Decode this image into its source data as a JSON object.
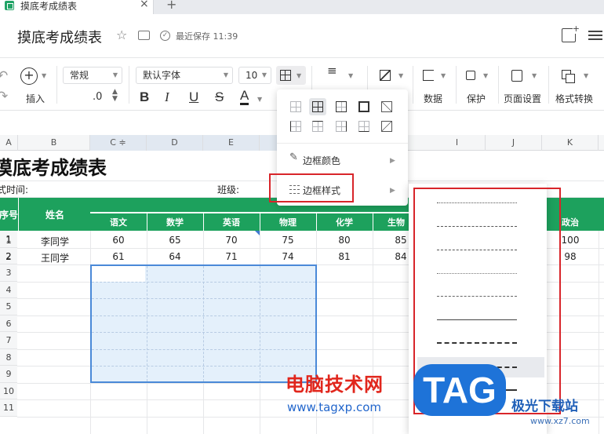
{
  "tab": {
    "title": "摸底考成绩表",
    "close": "×",
    "new": "+"
  },
  "header": {
    "title": "摸底考成绩表",
    "saved": "最近保存 11:39",
    "star": "☆"
  },
  "toolbar": {
    "insert_label": "插入",
    "number_format": "常规",
    "decimal": ".0",
    "font_name": "默认字体",
    "font_size": "10",
    "bold": "B",
    "italic": "I",
    "underline": "U",
    "strike": "S",
    "fontcolor": "A",
    "data_label": "数据",
    "protect_label": "保护",
    "page_setup_label": "页面设置",
    "format_convert_label": "格式转换"
  },
  "columns": [
    "A",
    "B",
    "C",
    "D",
    "E",
    "F",
    "I",
    "J",
    "K"
  ],
  "sheet": {
    "title": "摸底考成绩表",
    "exam_time": "式时间:",
    "class_label": "班级:",
    "header_seq": "序号",
    "header_name": "姓名",
    "subjects": [
      "语文",
      "数学",
      "英语",
      "物理",
      "化学",
      "生物",
      "政治"
    ],
    "rows": [
      {
        "seq": "1",
        "name": "李同学",
        "scores": [
          "60",
          "65",
          "70",
          "75",
          "80",
          "85",
          "100"
        ]
      },
      {
        "seq": "2",
        "name": "王同学",
        "scores": [
          "61",
          "64",
          "71",
          "74",
          "81",
          "84",
          "98"
        ]
      }
    ],
    "row_numbers": [
      "1",
      "2",
      "3",
      "4",
      "5",
      "6",
      "7",
      "8",
      "9",
      "10",
      "11"
    ]
  },
  "menu": {
    "border_color": "边框颜色",
    "border_style": "边框样式"
  },
  "watermark": {
    "site_cn": "电脑技术网",
    "site_url": "www.tagxp.com",
    "tag": "TAG",
    "brand": "极光下载站",
    "brand_url": "www.xz7.com"
  },
  "colors": {
    "green": "#1da15d",
    "selection": "#4a89d8",
    "highlight": "#d8252a"
  }
}
